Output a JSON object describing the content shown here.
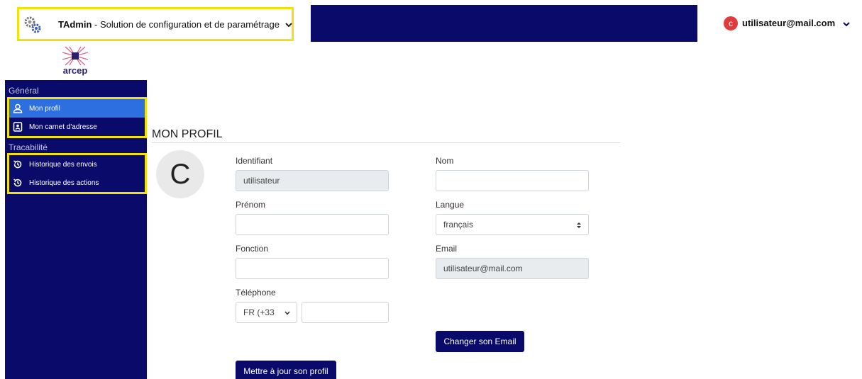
{
  "header": {
    "app_name": "TAdmin",
    "app_subtitle": " - Solution de configuration et de paramétrage",
    "user_initial": "c",
    "user_email": "utilisateur@mail.com"
  },
  "logo": {
    "text": "arcep"
  },
  "sidebar": {
    "sections": [
      {
        "label": "Général",
        "items": [
          {
            "label": "Mon profil",
            "icon": "user-icon",
            "active": true
          },
          {
            "label": "Mon carnet d'adresse",
            "icon": "address-book-icon"
          }
        ]
      },
      {
        "label": "Tracabilité",
        "items": [
          {
            "label": "Historique des envois",
            "icon": "history-icon"
          },
          {
            "label": "Historique des actions",
            "icon": "history-icon"
          }
        ]
      }
    ]
  },
  "main": {
    "title": "MON PROFIL",
    "avatar_initial": "C",
    "fields": {
      "identifiant": {
        "label": "Identifiant",
        "value": "utilisateur"
      },
      "nom": {
        "label": "Nom",
        "value": ""
      },
      "prenom": {
        "label": "Prénom",
        "value": ""
      },
      "langue": {
        "label": "Langue",
        "value": "français"
      },
      "fonction": {
        "label": "Fonction",
        "value": ""
      },
      "email": {
        "label": "Email",
        "value": "utilisateur@mail.com"
      },
      "telephone": {
        "label": "Téléphone",
        "country": "FR (+33",
        "value": ""
      }
    },
    "buttons": {
      "change_email": "Changer son Email",
      "update_profile": "Mettre à jour son profil"
    }
  },
  "colors": {
    "navy": "#0a0a6b",
    "active": "#2e6fe0",
    "highlight": "#f0e20a",
    "avatar": "#e23b3b"
  }
}
